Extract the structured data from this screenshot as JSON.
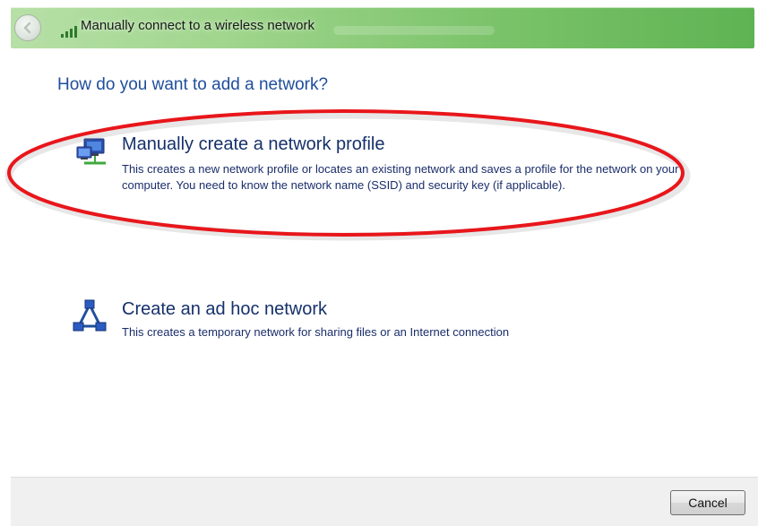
{
  "window": {
    "title": "Manually connect to a wireless network"
  },
  "titlebar": {
    "back_icon": "back-arrow-icon",
    "title_icon": "wireless-signal-icon"
  },
  "main": {
    "heading": "How do you want to add a network?",
    "options": [
      {
        "title": "Manually create a network profile",
        "description": "This creates a new network profile or locates an existing network and saves a profile for the network on your computer. You need to know the network name (SSID) and security key (if applicable).",
        "icon": "network-computers-icon",
        "highlighted": true,
        "highlight_color": "#e8161b"
      },
      {
        "title": "Create an ad hoc network",
        "description": "This creates a temporary network for sharing files or an Internet connection",
        "icon": "adhoc-network-icon",
        "highlighted": false
      }
    ]
  },
  "footer": {
    "cancel_label": "Cancel"
  },
  "colors": {
    "heading": "#1e4e9c",
    "option_title": "#15306b",
    "titlebar_green": "#7bc36a",
    "annotation_red": "#e8161b"
  }
}
